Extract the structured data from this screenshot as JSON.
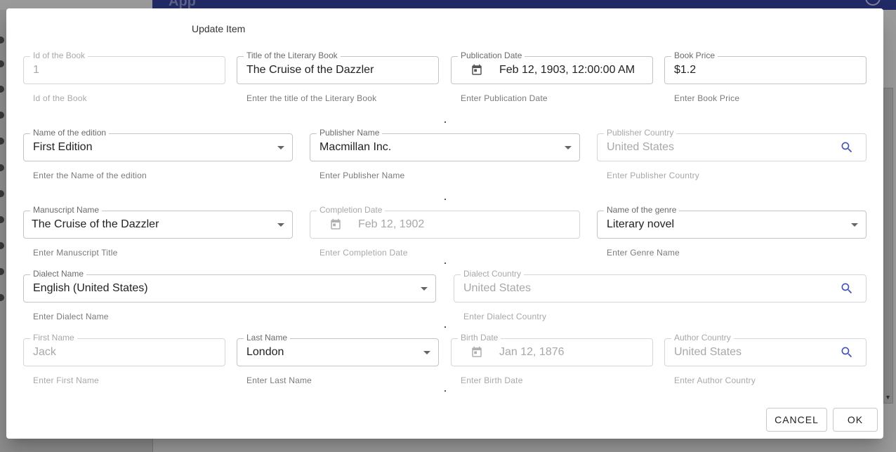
{
  "app": {
    "title": "App"
  },
  "dialog": {
    "title": "Update Item",
    "buttons": {
      "cancel": "CANCEL",
      "ok": "OK"
    }
  },
  "fields": {
    "book_id": {
      "label": "Id of the Book",
      "value": "1",
      "hint": "Id of the Book"
    },
    "book_title": {
      "label": "Title of the Literary Book",
      "value": "The Cruise of the Dazzler",
      "hint": "Enter the title of the Literary Book"
    },
    "publication_date": {
      "label": "Publication Date",
      "value": "Feb 12, 1903, 12:00:00 AM",
      "hint": "Enter Publication Date"
    },
    "book_price": {
      "label": "Book Price",
      "value": "$1.2",
      "hint": "Enter Book Price"
    },
    "edition_name": {
      "label": "Name of the edition",
      "value": "First Edition",
      "hint": "Enter the Name of the edition"
    },
    "publisher_name": {
      "label": "Publisher Name",
      "value": "Macmillan Inc.",
      "hint": "Enter Publisher Name"
    },
    "publisher_country": {
      "label": "Publisher Country",
      "value": "United States",
      "hint": "Enter Publisher Country"
    },
    "manuscript_name": {
      "label": "Manuscript Name",
      "value": "The Cruise of the Dazzler",
      "hint": "Enter Manuscript Title"
    },
    "completion_date": {
      "label": "Completion Date",
      "value": "Feb 12, 1902",
      "hint": "Enter Completion Date"
    },
    "genre_name": {
      "label": "Name of the genre",
      "value": "Literary novel",
      "hint": "Enter Genre Name"
    },
    "dialect_name": {
      "label": "Dialect Name",
      "value": "English (United States)",
      "hint": "Enter Dialect Name"
    },
    "dialect_country": {
      "label": "Dialect Country",
      "value": "United States",
      "hint": "Enter Dialect Country"
    },
    "first_name": {
      "label": "First Name",
      "value": "Jack",
      "hint": "Enter First Name"
    },
    "last_name": {
      "label": "Last Name",
      "value": "London",
      "hint": "Enter Last Name"
    },
    "birth_date": {
      "label": "Birth Date",
      "value": "Jan 12, 1876",
      "hint": "Enter Birth Date"
    },
    "author_country": {
      "label": "Author Country",
      "value": "United States",
      "hint": "Enter Author Country"
    }
  },
  "colors": {
    "accent": "#3f51b5",
    "app_bar": "#222a66"
  }
}
